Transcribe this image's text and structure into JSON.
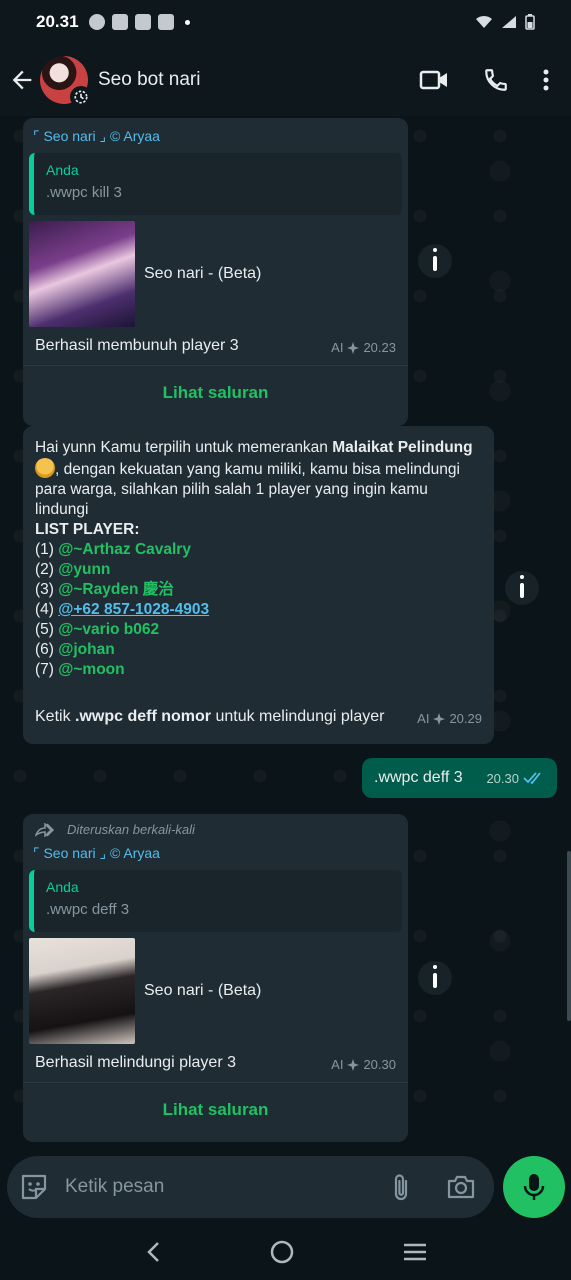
{
  "status": {
    "time": "20.31"
  },
  "header": {
    "contact_name": "Seo bot nari"
  },
  "messages": {
    "m1": {
      "channel": "⌜ Seo nari ⌟ © Aryaa",
      "quote_name": "Anda",
      "quote_text": ".wwpc kill 3",
      "media_title": "Seo nari - (Beta)",
      "text": "Berhasil membunuh player 3",
      "ai_label": "AI",
      "time": "20.23",
      "cta": "Lihat saluran"
    },
    "m2": {
      "intro_a": "Hai yunn Kamu terpilih untuk memerankan ",
      "intro_role": "Malaikat Pelindung",
      "intro_b": ", dengan kekuatan yang kamu miliki, kamu bisa melindungi para warga, silahkan pilih salah 1 player yang ingin kamu lindungi",
      "list_title": "LIST PLAYER:",
      "players": [
        {
          "num": "(1) ",
          "name": "@~Arthaz Cavalry"
        },
        {
          "num": "(2) ",
          "name": "@yunn"
        },
        {
          "num": "(3) ",
          "name": "@~Rayden 慶治"
        },
        {
          "num": "(4) ",
          "name": "@+62 857-1028-4903"
        },
        {
          "num": "(5) ",
          "name": "@~vario b062"
        },
        {
          "num": "(6) ",
          "name": "@johan"
        },
        {
          "num": "(7) ",
          "name": "@~moon"
        }
      ],
      "footer_a": "Ketik ",
      "footer_cmd": ".wwpc deff nomor",
      "footer_b": " untuk melindungi player",
      "ai_label": "AI",
      "time": "20.29"
    },
    "m3": {
      "text": ".wwpc deff 3",
      "time": "20.30"
    },
    "m4": {
      "forwarded": "Diteruskan berkali-kali",
      "channel": "⌜ Seo nari ⌟ © Aryaa",
      "quote_name": "Anda",
      "quote_text": ".wwpc deff 3",
      "media_title": "Seo nari - (Beta)",
      "text": "Berhasil melindungi player 3",
      "ai_label": "AI",
      "time": "20.30",
      "cta": "Lihat saluran"
    }
  },
  "composer": {
    "placeholder": "Ketik pesan"
  },
  "colors": {
    "accent": "#21c063",
    "outgoing": "#005c4b",
    "incoming": "#1f2c33",
    "link": "#53bdeb"
  },
  "icons": [
    "back-arrow-icon",
    "video-call-icon",
    "phone-icon",
    "more-icon",
    "info-icon",
    "forward-icon",
    "read-ticks-icon",
    "sticker-icon",
    "attach-icon",
    "camera-icon",
    "mic-icon"
  ]
}
